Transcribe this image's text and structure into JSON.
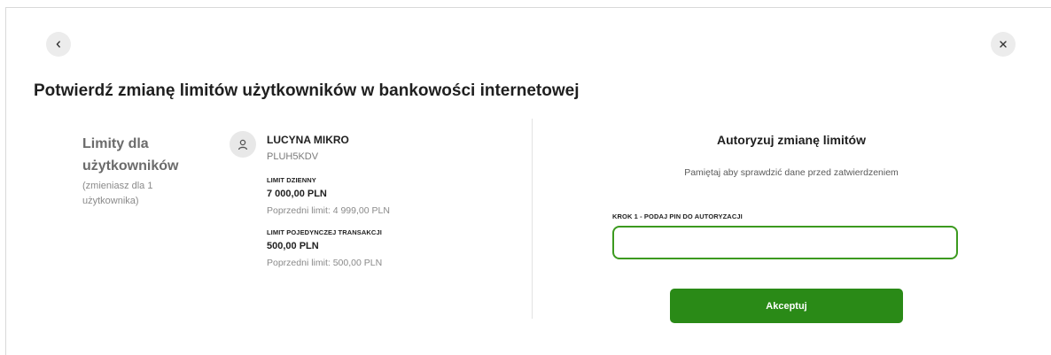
{
  "header": {
    "back_icon": "chevron-left-icon",
    "close_icon": "close-icon",
    "title": "Potwierdź zmianę limitów użytkowników w bankowości internetowej"
  },
  "summary": {
    "heading_line1": "Limity dla",
    "heading_line2": "użytkowników",
    "note_line1": "(zmieniasz dla 1",
    "note_line2": "użytkownika)"
  },
  "user": {
    "avatar_icon": "user-icon",
    "name": "LUCYNA MIKRO",
    "id": "PLUH5KDV",
    "limits": [
      {
        "label": "LIMIT DZIENNY",
        "value": "7 000,00 PLN",
        "previous": "Poprzedni limit: 4 999,00 PLN"
      },
      {
        "label": "LIMIT POJEDYNCZEJ TRANSAKCJI",
        "value": "500,00 PLN",
        "previous": "Poprzedni limit: 500,00 PLN"
      }
    ]
  },
  "auth": {
    "title": "Autoryzuj zmianę limitów",
    "subtitle": "Pamiętaj aby sprawdzić dane przed zatwierdzeniem",
    "pin_label": "KROK 1 - PODAJ PIN DO AUTORYZACJI",
    "pin_value": "",
    "accept_label": "Akceptuj"
  },
  "colors": {
    "accent_green": "#2a8a17",
    "input_border": "#3c9a1f"
  }
}
